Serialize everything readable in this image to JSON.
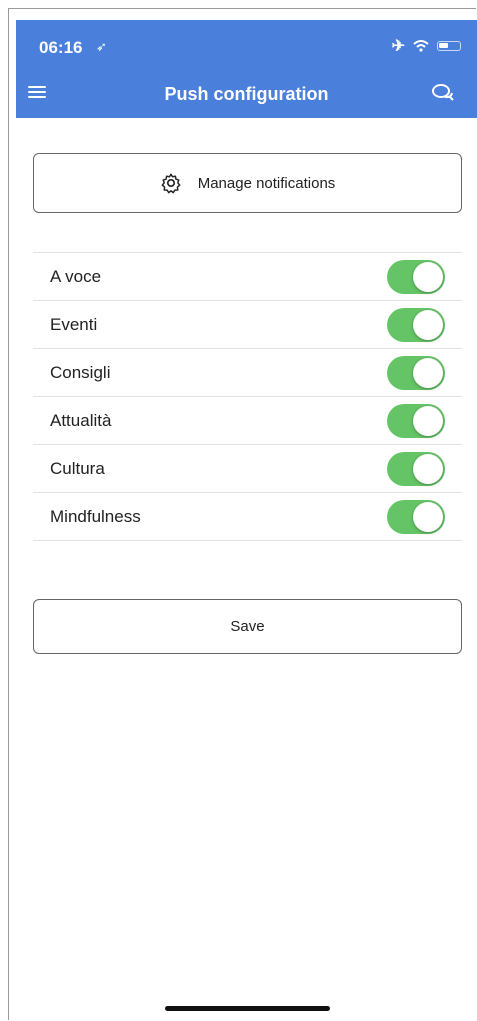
{
  "status_bar": {
    "time": "06:16",
    "location_icon": "location-arrow-icon",
    "airplane_icon": "airplane-icon",
    "wifi_icon": "wifi-icon",
    "battery_icon": "battery-icon",
    "battery_level": 0.45
  },
  "header": {
    "title": "Push configuration",
    "menu_icon": "hamburger-menu-icon",
    "chat_icon": "chat-bubbles-icon",
    "background_color": "#4a7fdc"
  },
  "manage_button": {
    "label": "Manage notifications",
    "icon": "gear-icon"
  },
  "topics": [
    {
      "label": "A voce",
      "enabled": true
    },
    {
      "label": "Eventi",
      "enabled": true
    },
    {
      "label": "Consigli",
      "enabled": true
    },
    {
      "label": "Attualità",
      "enabled": true
    },
    {
      "label": "Cultura",
      "enabled": true
    },
    {
      "label": "Mindfulness",
      "enabled": true
    }
  ],
  "toggle_on_color": "#65c466",
  "save_button": {
    "label": "Save"
  }
}
